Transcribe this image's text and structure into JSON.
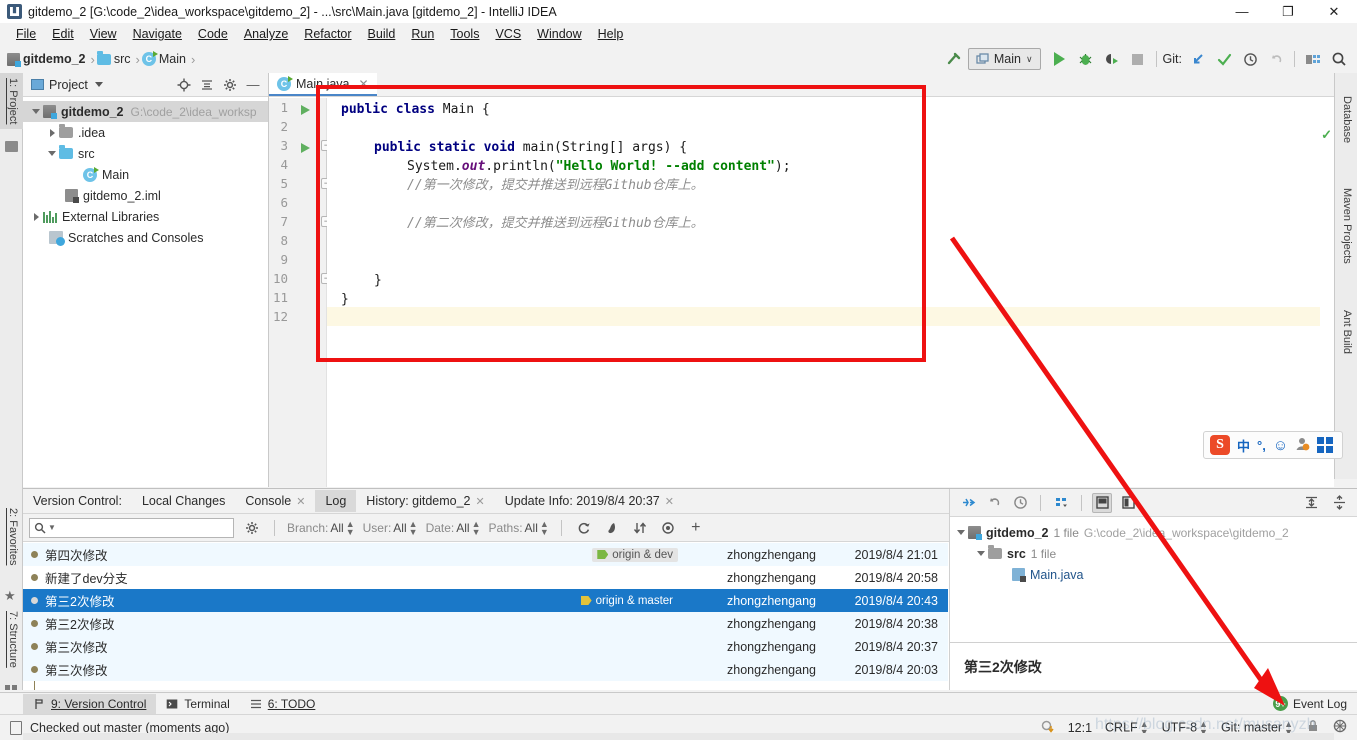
{
  "window": {
    "title": "gitdemo_2 [G:\\code_2\\idea_workspace\\gitdemo_2] - ...\\src\\Main.java [gitdemo_2] - IntelliJ IDEA",
    "app_icon": "intellij-idea-icon",
    "minimize": "—",
    "maximize": "❐",
    "close": "✕"
  },
  "menu": {
    "items": [
      "File",
      "Edit",
      "View",
      "Navigate",
      "Code",
      "Analyze",
      "Refactor",
      "Build",
      "Run",
      "Tools",
      "VCS",
      "Window",
      "Help"
    ]
  },
  "breadcrumb": {
    "items": [
      {
        "label": "gitdemo_2",
        "icon": "module-icon",
        "bold": true
      },
      {
        "label": "src",
        "icon": "folder-icon",
        "bold": false
      },
      {
        "label": "Main",
        "icon": "java-class-icon",
        "bold": false
      }
    ],
    "separator": "›"
  },
  "toolbar": {
    "build_icon": "hammer-icon",
    "run_config": "Main",
    "run_config_icon": "run-configuration-icon",
    "dropdown": "∨",
    "run_icon": "run-icon",
    "debug_icon": "debug-icon",
    "run_coverage_icon": "run-with-coverage-icon",
    "stop_icon": "stop-icon",
    "git_label": "Git:",
    "update_icon": "update-project-icon",
    "commit_icon": "commit-icon",
    "history_icon": "history-icon",
    "rollback_icon": "rollback-icon",
    "settings_icon": "settings-icon",
    "search_icon": "search-everywhere-icon"
  },
  "left_strip": {
    "top_tabs": [
      {
        "label": "1: Project",
        "selected": true,
        "icon": "project-icon"
      }
    ],
    "bottom_tabs": [
      {
        "label": "2: Favorites",
        "icon": "star-icon"
      },
      {
        "label": "7: Structure",
        "icon": "structure-icon"
      }
    ]
  },
  "right_strip": {
    "tabs": [
      {
        "label": "Database",
        "icon": "database-icon"
      },
      {
        "label": "Maven Projects",
        "icon": "maven-icon"
      },
      {
        "label": "Ant Build",
        "icon": "ant-icon"
      }
    ]
  },
  "project_panel": {
    "title": "Project",
    "dropdown_icon": "chevron-down-icon",
    "locate_icon": "locate-icon",
    "collapse_icon": "collapse-all-icon",
    "gear_icon": "gear-icon",
    "hide_icon": "hide-icon",
    "tree": [
      {
        "label": "gitdemo_2",
        "sub": "G:\\code_2\\idea_worksp",
        "indent": 0,
        "twisty": "down",
        "icon": "module-icon",
        "bold": true,
        "selected": true
      },
      {
        "label": ".idea",
        "sub": "",
        "indent": 1,
        "twisty": "right",
        "icon": "folder-grey-icon",
        "bold": false,
        "selected": false
      },
      {
        "label": "src",
        "sub": "",
        "indent": 1,
        "twisty": "down",
        "icon": "folder-icon",
        "bold": false,
        "selected": false
      },
      {
        "label": "Main",
        "sub": "",
        "indent": 2,
        "twisty": "none",
        "icon": "java-class-icon",
        "bold": false,
        "selected": false
      },
      {
        "label": "gitdemo_2.iml",
        "sub": "",
        "indent": 1,
        "twisty": "none",
        "icon": "iml-icon",
        "bold": false,
        "selected": false
      },
      {
        "label": "External Libraries",
        "sub": "",
        "indent": 0,
        "twisty": "right",
        "icon": "library-icon",
        "bold": false,
        "selected": false
      },
      {
        "label": "Scratches and Consoles",
        "sub": "",
        "indent": 0,
        "twisty": "none",
        "icon": "scratches-icon",
        "bold": false,
        "selected": false
      }
    ]
  },
  "editor": {
    "tab": {
      "label": "Main.java",
      "icon": "java-class-icon",
      "close": "✕"
    },
    "current_line": 12,
    "total_lines": 12,
    "gutter_run_lines": [
      1,
      3
    ],
    "fold_lines": [
      3,
      5,
      7,
      10
    ],
    "lines": [
      {
        "n": 1,
        "tokens": [
          {
            "t": "public ",
            "c": "kw"
          },
          {
            "t": "class ",
            "c": "kw"
          },
          {
            "t": "Main {",
            "c": "pln"
          }
        ],
        "indent": 0
      },
      {
        "n": 2,
        "tokens": [],
        "indent": 0
      },
      {
        "n": 3,
        "tokens": [
          {
            "t": "public ",
            "c": "kw"
          },
          {
            "t": "static ",
            "c": "kw"
          },
          {
            "t": "void ",
            "c": "kw"
          },
          {
            "t": "main(String[] args) {",
            "c": "pln"
          }
        ],
        "indent": 1
      },
      {
        "n": 4,
        "tokens": [
          {
            "t": "System.",
            "c": "pln"
          },
          {
            "t": "out",
            "c": "fld"
          },
          {
            "t": ".println(",
            "c": "pln"
          },
          {
            "t": "\"Hello World! --add content\"",
            "c": "str"
          },
          {
            "t": ");",
            "c": "pln"
          }
        ],
        "indent": 2
      },
      {
        "n": 5,
        "tokens": [
          {
            "t": "//第一次修改，提交并推送到远程Github仓库上。",
            "c": "cmt"
          }
        ],
        "indent": 2
      },
      {
        "n": 6,
        "tokens": [],
        "indent": 0
      },
      {
        "n": 7,
        "tokens": [
          {
            "t": "//第二次修改，提交并推送到远程Github仓库上。",
            "c": "cmt"
          }
        ],
        "indent": 2
      },
      {
        "n": 8,
        "tokens": [],
        "indent": 0
      },
      {
        "n": 9,
        "tokens": [],
        "indent": 0
      },
      {
        "n": 10,
        "tokens": [
          {
            "t": "}",
            "c": "pln"
          }
        ],
        "indent": 1
      },
      {
        "n": 11,
        "tokens": [
          {
            "t": "}",
            "c": "pln"
          }
        ],
        "indent": 0
      },
      {
        "n": 12,
        "tokens": [],
        "indent": 0
      }
    ],
    "inspection_status": "✓"
  },
  "ime": {
    "logo": "S",
    "mode": "中",
    "punctuation": "°,",
    "emoji": "☺",
    "user_icon": "user-icon",
    "toolbox_icon": "toolbox-icon"
  },
  "vcs_panel": {
    "label": "Version Control:",
    "tabs": [
      {
        "label": "Local Changes",
        "closable": false,
        "selected": false
      },
      {
        "label": "Console",
        "closable": true,
        "selected": false
      },
      {
        "label": "Log",
        "closable": false,
        "selected": true
      },
      {
        "label": "History: gitdemo_2",
        "closable": true,
        "selected": false
      },
      {
        "label": "Update Info: 2019/8/4 20:37",
        "closable": true,
        "selected": false
      }
    ],
    "gear_icon": "gear-icon",
    "hide_icon": "hide-icon",
    "filters": {
      "search_placeholder": "",
      "search_icon": "search-icon",
      "gear_icon": "gear-icon",
      "items": [
        {
          "label": "Branch:",
          "value": "All"
        },
        {
          "label": "User:",
          "value": "All"
        },
        {
          "label": "Date:",
          "value": "All"
        },
        {
          "label": "Paths:",
          "value": "All"
        }
      ],
      "refresh_icon": "refresh-icon",
      "ignore_icon": "ignore-icon",
      "sort_icon": "sort-icon",
      "eye_icon": "eye-icon",
      "plus_icon": "plus-icon",
      "find_icon": "find-icon"
    },
    "commits": [
      {
        "message": "第四次修改",
        "tag": "origin & dev",
        "tag_color": "green",
        "author": "zhongzhengang",
        "date": "2019/8/4 21:01",
        "selected": false
      },
      {
        "message": "新建了dev分支",
        "tag": "",
        "tag_color": "",
        "author": "zhongzhengang",
        "date": "2019/8/4 20:58",
        "selected": false
      },
      {
        "message": "第三2次修改",
        "tag": "origin & master",
        "tag_color": "yellow",
        "author": "zhongzhengang",
        "date": "2019/8/4 20:43",
        "selected": true
      },
      {
        "message": "第三2次修改",
        "tag": "",
        "tag_color": "",
        "author": "zhongzhengang",
        "date": "2019/8/4 20:38",
        "selected": false
      },
      {
        "message": "第三次修改",
        "tag": "",
        "tag_color": "",
        "author": "zhongzhengang",
        "date": "2019/8/4 20:37",
        "selected": false
      },
      {
        "message": "第三次修改",
        "tag": "",
        "tag_color": "",
        "author": "zhongzhengang",
        "date": "2019/8/4 20:03",
        "selected": false
      }
    ],
    "details": {
      "tools": {
        "expand_icon": "expand-selection-icon",
        "revert_icon": "revert-icon",
        "history_icon": "history-icon",
        "group_icon": "group-by-icon",
        "preview_icon": "preview-diff-icon",
        "side_icon": "side-by-side-icon",
        "expand_all_icon": "expand-all-icon",
        "collapse_all_icon": "collapse-all-icon"
      },
      "tree": [
        {
          "label": "gitdemo_2",
          "count": "1 file",
          "path": "G:\\code_2\\idea_workspace\\gitdemo_2",
          "indent": 0,
          "twisty": "down",
          "icon": "module-icon"
        },
        {
          "label": "src",
          "count": "1 file",
          "path": "",
          "indent": 1,
          "twisty": "down",
          "icon": "folder-icon"
        },
        {
          "label": "Main.java",
          "count": "",
          "path": "",
          "indent": 2,
          "twisty": "none",
          "icon": "java-file-icon"
        }
      ],
      "commit_message": "第三2次修改"
    }
  },
  "bottom_strip": {
    "tabs": [
      {
        "label": "9: Version Control",
        "icon": "vcs-icon",
        "selected": true
      },
      {
        "label": "Terminal",
        "icon": "terminal-icon",
        "selected": false
      },
      {
        "label": "6: TODO",
        "icon": "todo-icon",
        "selected": false
      }
    ],
    "event_log": {
      "label": "Event Log",
      "badge": "9+"
    }
  },
  "status_bar": {
    "icon": "document-icon",
    "message": "Checked out master (moments ago)",
    "background_icon": "background-tasks-icon",
    "caret": "12:1",
    "line_separator": "CRLF",
    "encoding": "UTF-8",
    "branch_label": "Git: master",
    "lock_icon": "lock-icon",
    "inspection_icon": "inspection-icon"
  },
  "watermark": "https://blog.csdn.net/musanyzh",
  "annotation": {
    "color": "#ee1111",
    "rect": "highlight-code-rectangle",
    "arrow": "pointer-arrow-to-event-log"
  }
}
